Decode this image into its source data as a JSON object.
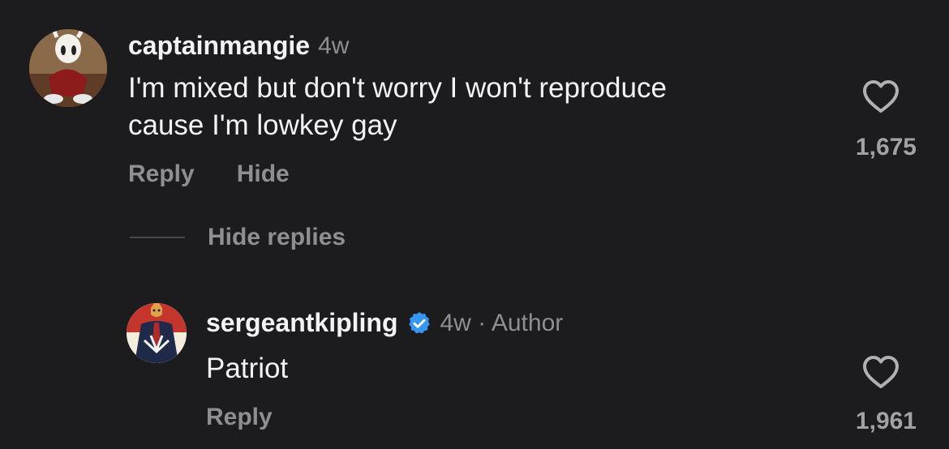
{
  "comments": [
    {
      "username": "captainmangie",
      "meta": "4w",
      "text_line1": "I'm mixed but don't worry I won't reproduce",
      "text_line2": "cause I'm lowkey gay",
      "actions": {
        "reply": "Reply",
        "hide": "Hide"
      },
      "like_count": "1,675",
      "icon": "heart-outline-icon"
    }
  ],
  "hide_replies_label": "Hide replies",
  "reply": {
    "username": "sergeantkipling",
    "meta": "4w · Author",
    "text": "Patriot",
    "actions": {
      "reply": "Reply"
    },
    "like_count": "1,961",
    "verified_color": "#3797f0"
  },
  "colors": {
    "background": "#1c1c1e",
    "primary_text": "#f2f2f7",
    "secondary_text": "#8e8e93"
  }
}
